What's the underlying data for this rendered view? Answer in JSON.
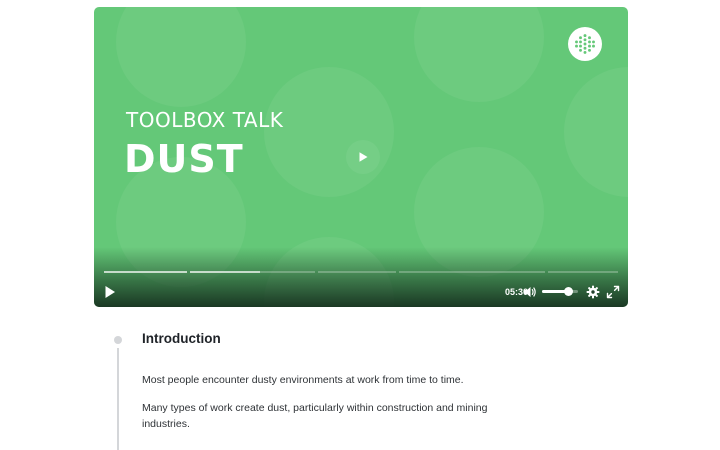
{
  "video": {
    "kicker": "TOOLBOX TALK",
    "headline": "DUST",
    "background_color": "#64c878",
    "logo_icon": "dotted-sphere-logo",
    "big_play_icon": "play-icon",
    "controls": {
      "play_icon": "play-icon",
      "time": "05:30",
      "mute_icon": "volume-icon",
      "volume_level": 0.72,
      "settings_icon": "gear-icon",
      "fullscreen_icon": "fullscreen-icon"
    }
  },
  "lesson": {
    "section_title": "Introduction",
    "paragraphs": [
      "Most people encounter dusty environments at work from time to time.",
      "Many types of work create dust, particularly within construction and mining industries.",
      ""
    ]
  }
}
